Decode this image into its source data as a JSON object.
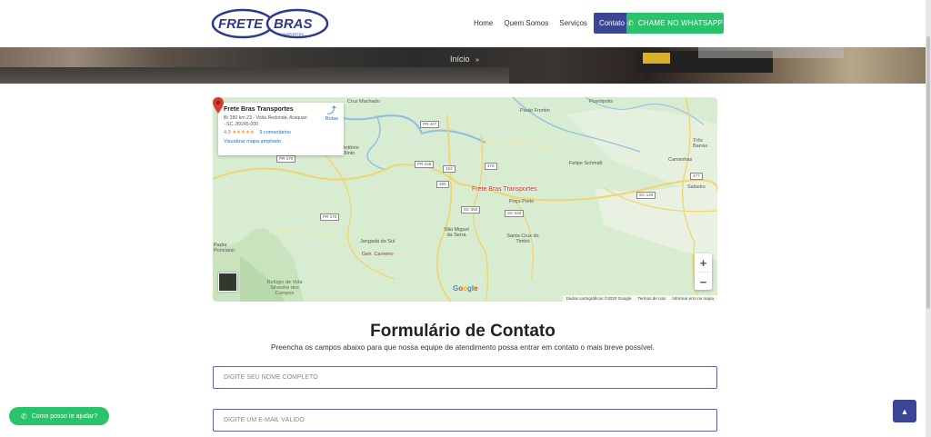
{
  "header": {
    "logo": {
      "text": "FRETE BRAS",
      "subtext": "TRANSPORTES"
    },
    "nav": [
      {
        "label": "Home"
      },
      {
        "label": "Quem Somos"
      },
      {
        "label": "Serviços"
      },
      {
        "label": "Contato",
        "active": true
      }
    ],
    "whatsapp_button": {
      "label": "CHAME NO WHATSAPP",
      "icon": "phone-icon"
    }
  },
  "banner": {
    "breadcrumb": "Início",
    "separator": "»"
  },
  "map": {
    "place": {
      "name": "Frete Bras Transportes",
      "address": "Br 280 km 23 - Volta Redonda, Araquari - SC, 89245-000",
      "rating": "4,9",
      "stars": "★★★★★",
      "reviews": "9 comentários",
      "view_larger": "Visualizar mapa ampliado",
      "directions": "Rotas"
    },
    "marker_label": "Frete Bras Transportes",
    "labels": [
      "Cruz Machado",
      "Paulo Frontin",
      "Fluviópolis",
      "Três Barras",
      "Felipe Schmidt",
      "Canoinhas",
      "Salseiro",
      "Antônio Olinto",
      "Poço Preto",
      "São Miguel da Serra",
      "Santa Cruz do Timbó",
      "Jangada do Sul",
      "Gen. Carneiro",
      "Padre Ponciano",
      "Refúgio de Vida Silvestre dos Campos"
    ],
    "roads": [
      "PR-447",
      "PR-446",
      "153",
      "476",
      "280",
      "SC-350",
      "SC-340",
      "PR-170",
      "SC-120",
      "477",
      "PR-170"
    ],
    "zoom_in": "+",
    "zoom_out": "−",
    "google": "Google",
    "footer": [
      "Dados cartográficos ©2020 Google",
      "Termos de Uso",
      "Informar erro no mapa"
    ]
  },
  "form": {
    "title": "Formulário de Contato",
    "subtitle": "Preencha os campos abaixo para que nossa equipe de atendimento possa entrar em contato o mais breve possível.",
    "name_placeholder": "DIGITE SEU NOME COMPLETO",
    "email_placeholder": "DIGITE UM E-MAIL VÁLIDO"
  },
  "chat_button": {
    "label": "Como posso te ajudar?",
    "icon": "whatsapp-icon"
  },
  "scroll_top": {
    "icon": "arrow-up-icon"
  },
  "colors": {
    "brand": "#3a4595",
    "whatsapp": "#28c36b",
    "marker": "#d93a30"
  }
}
